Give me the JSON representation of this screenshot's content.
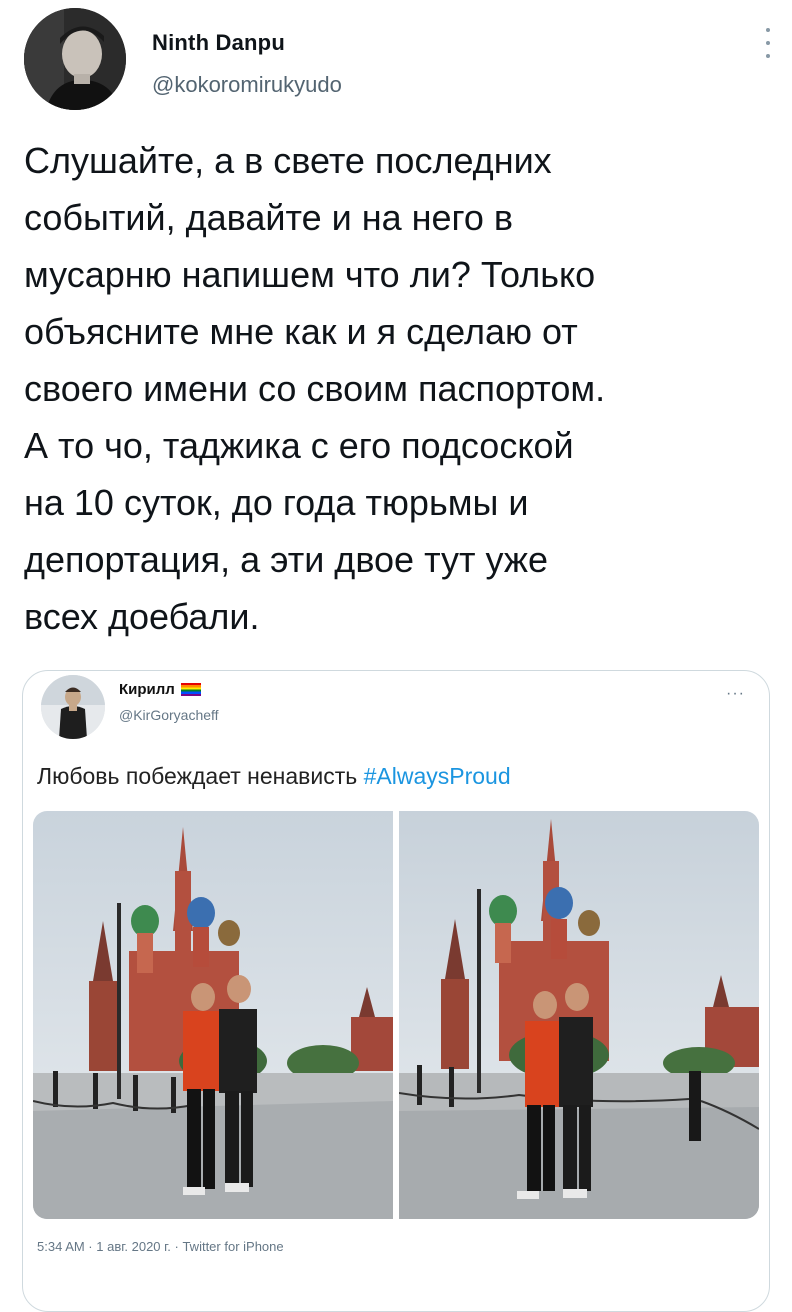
{
  "tweet": {
    "author_name": "Ninth Danpu",
    "author_handle": "@kokoromirukyudo",
    "text_lines": [
      "Слушайте, а в свете последних",
      "событий, давайте и на него в",
      "мусарню напишем что ли? Только",
      "объясните мне как и я сделаю от",
      "своего имени со своим паспортом.",
      "А то чо, таджика с его подсоской",
      "на 10 суток, до года тюрьмы и",
      "депортация, а эти двое тут уже",
      "всех доебали."
    ]
  },
  "quoted_tweet": {
    "author_name": "Кирилл",
    "author_handle": "@KirGoryacheff",
    "more": "···",
    "text": "Любовь побеждает ненависть ",
    "hashtag": "#AlwaysProud",
    "meta": "5:34 AM · 1 авг. 2020 г. · Twitter for iPhone",
    "photos": [
      "photo-1",
      "photo-2"
    ]
  },
  "icons": {
    "more": "vertical-ellipsis-icon",
    "flag": "rainbow-flag-icon"
  },
  "colors": {
    "text": "#0f1419",
    "secondary": "#536471",
    "link": "#1b95e0",
    "border": "#cfd9de"
  }
}
